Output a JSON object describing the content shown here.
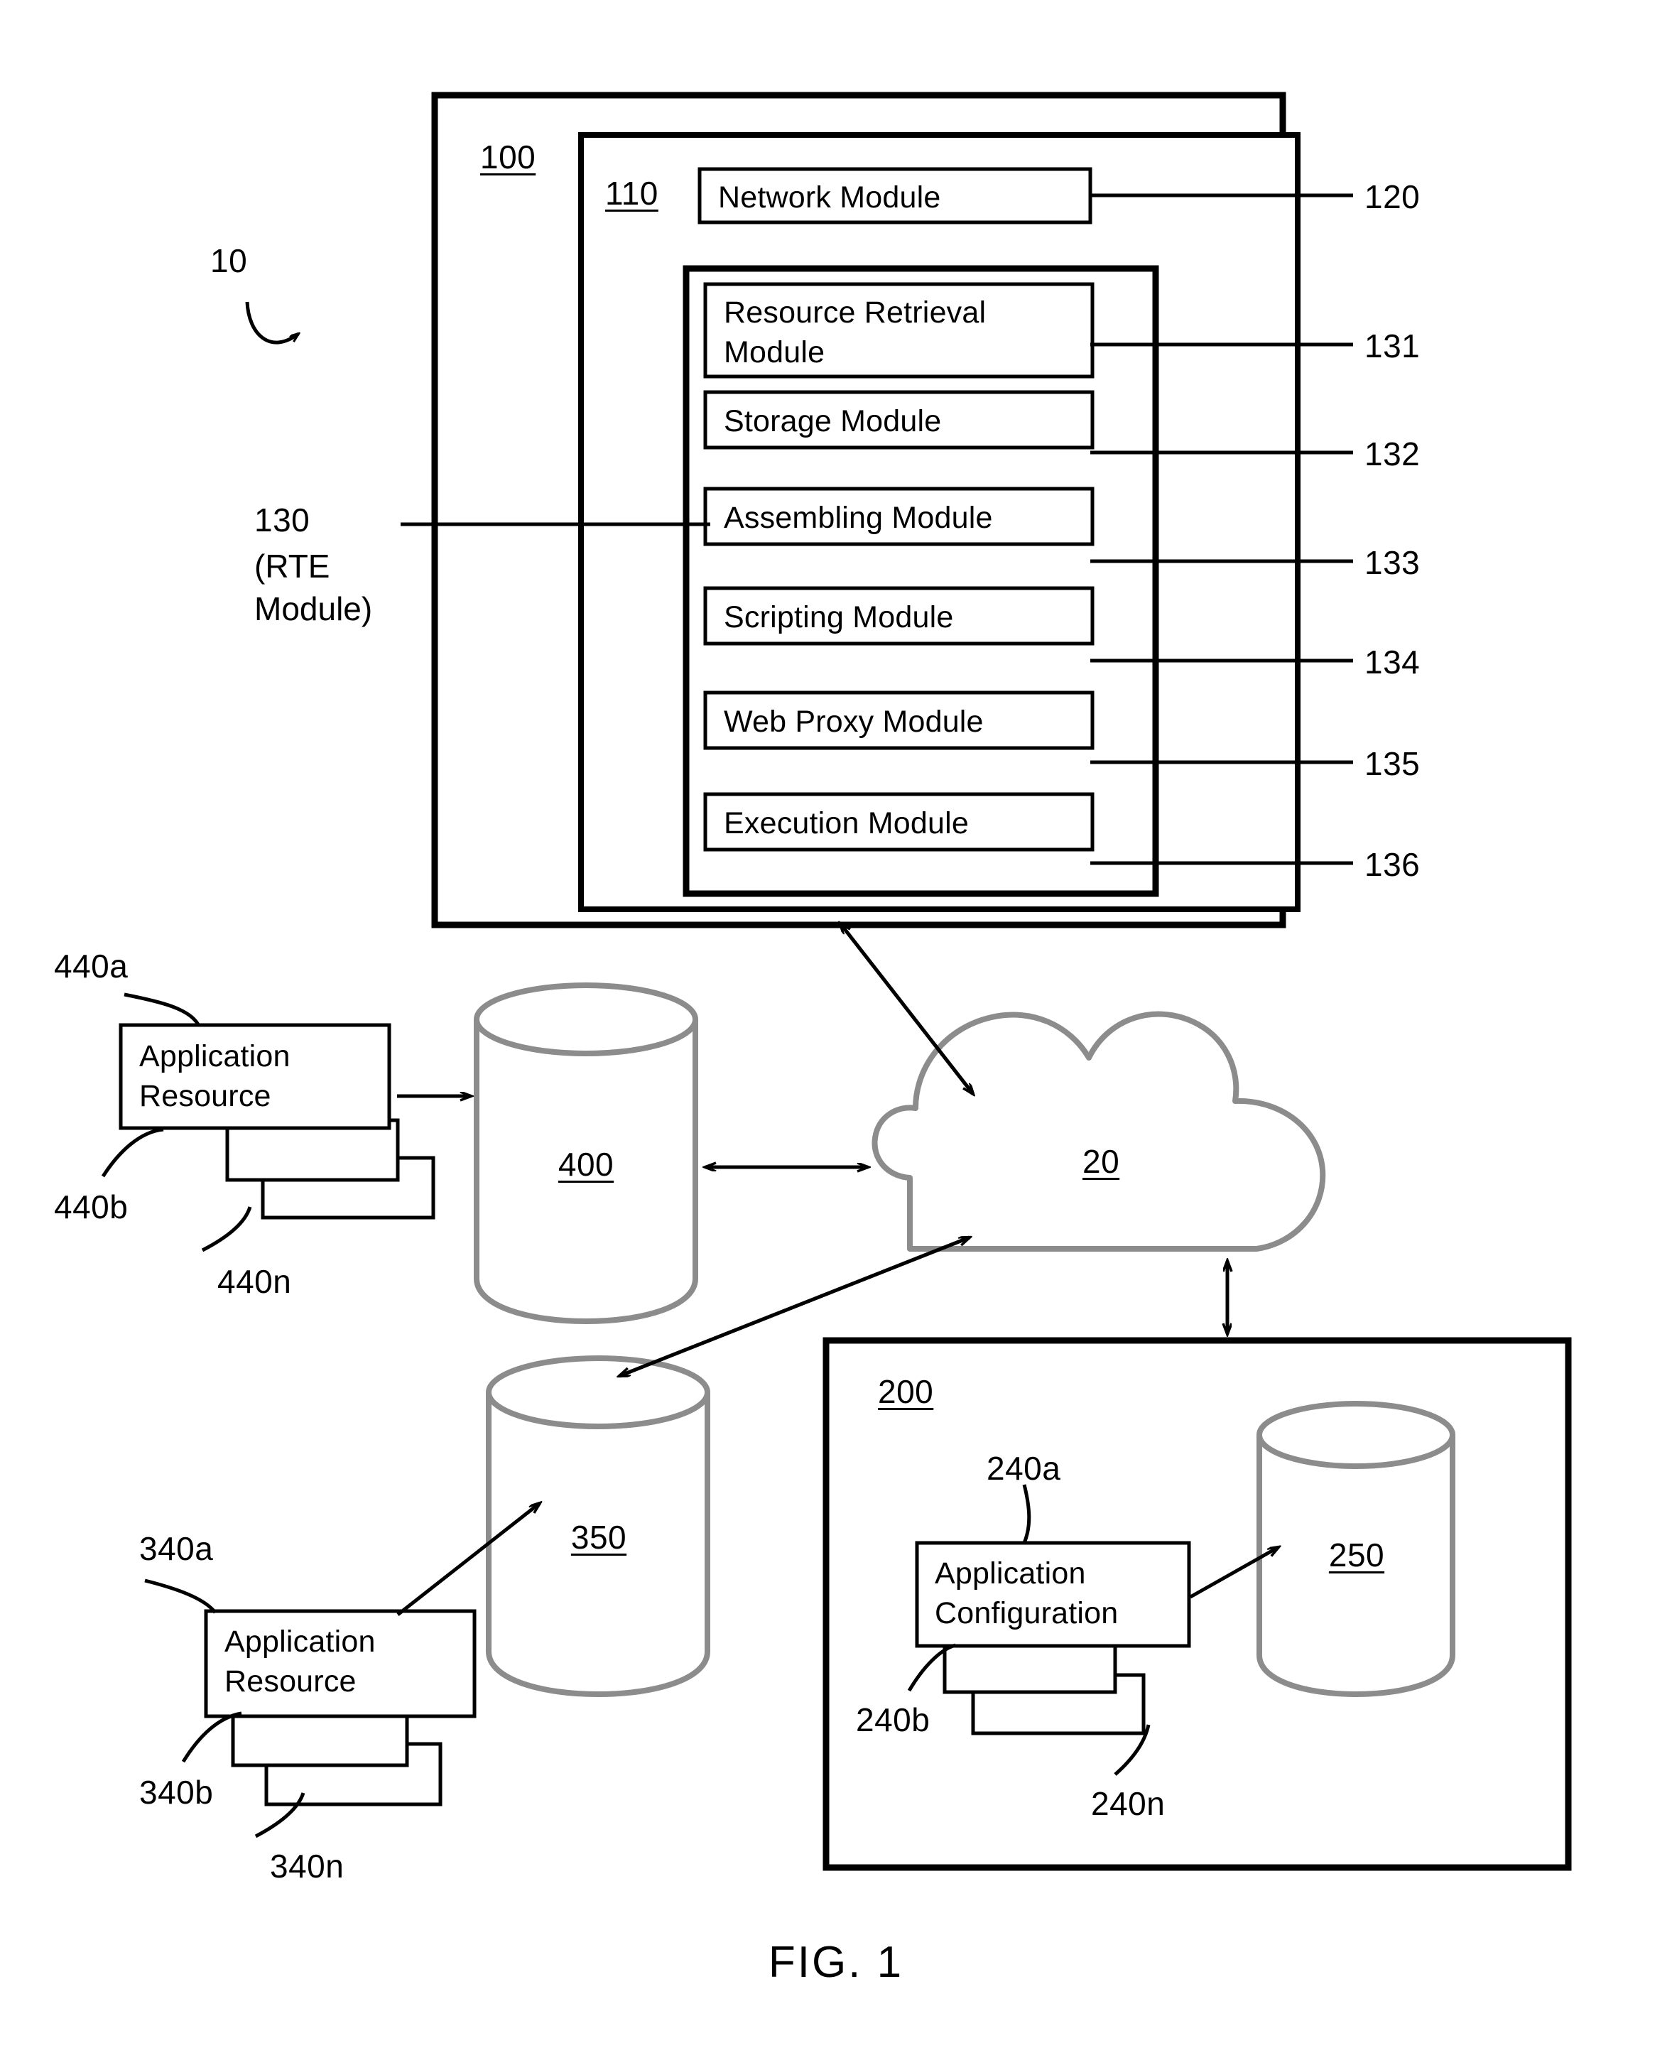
{
  "figure": {
    "caption": "FIG. 1",
    "system_ref": "10"
  },
  "system_box": {
    "ref": "100",
    "inner_box_ref": "110",
    "rte_group": {
      "ref": "130",
      "name": "(RTE\nModule)"
    },
    "modules": [
      {
        "label": "Network Module",
        "ref": "120"
      },
      {
        "label": "Resource Retrieval\nModule",
        "ref": "131"
      },
      {
        "label": "Storage Module",
        "ref": "132"
      },
      {
        "label": "Assembling Module",
        "ref": "133"
      },
      {
        "label": "Scripting Module",
        "ref": "134"
      },
      {
        "label": "Web Proxy Module",
        "ref": "135"
      },
      {
        "label": "Execution Module",
        "ref": "136"
      }
    ]
  },
  "cloud": {
    "ref": "20"
  },
  "upper_left_group": {
    "stack_label": "Application\nResource",
    "refs": {
      "first": "440a",
      "second": "440b",
      "last": "440n"
    },
    "datastore_ref": "400"
  },
  "lower_left_group": {
    "stack_label": "Application\nResource",
    "refs": {
      "first": "340a",
      "second": "340b",
      "last": "340n"
    },
    "datastore_ref": "350"
  },
  "server_box": {
    "ref": "200",
    "stack_label": "Application\nConfiguration",
    "refs": {
      "first": "240a",
      "second": "240b",
      "last": "240n"
    },
    "datastore_ref": "250"
  },
  "colors": {
    "line": "#000000",
    "cylinder": "#8c8c8c",
    "background": "#ffffff"
  }
}
